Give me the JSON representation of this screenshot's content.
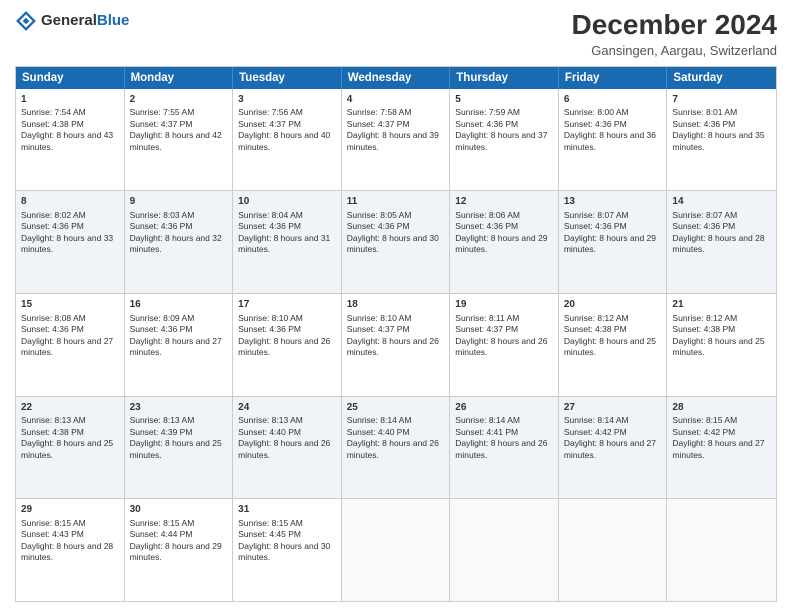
{
  "header": {
    "logo_general": "General",
    "logo_blue": "Blue",
    "title": "December 2024",
    "subtitle": "Gansingen, Aargau, Switzerland"
  },
  "calendar": {
    "days": [
      "Sunday",
      "Monday",
      "Tuesday",
      "Wednesday",
      "Thursday",
      "Friday",
      "Saturday"
    ],
    "weeks": [
      [
        {
          "day": "1",
          "sunrise": "Sunrise: 7:54 AM",
          "sunset": "Sunset: 4:38 PM",
          "daylight": "Daylight: 8 hours and 43 minutes."
        },
        {
          "day": "2",
          "sunrise": "Sunrise: 7:55 AM",
          "sunset": "Sunset: 4:37 PM",
          "daylight": "Daylight: 8 hours and 42 minutes."
        },
        {
          "day": "3",
          "sunrise": "Sunrise: 7:56 AM",
          "sunset": "Sunset: 4:37 PM",
          "daylight": "Daylight: 8 hours and 40 minutes."
        },
        {
          "day": "4",
          "sunrise": "Sunrise: 7:58 AM",
          "sunset": "Sunset: 4:37 PM",
          "daylight": "Daylight: 8 hours and 39 minutes."
        },
        {
          "day": "5",
          "sunrise": "Sunrise: 7:59 AM",
          "sunset": "Sunset: 4:36 PM",
          "daylight": "Daylight: 8 hours and 37 minutes."
        },
        {
          "day": "6",
          "sunrise": "Sunrise: 8:00 AM",
          "sunset": "Sunset: 4:36 PM",
          "daylight": "Daylight: 8 hours and 36 minutes."
        },
        {
          "day": "7",
          "sunrise": "Sunrise: 8:01 AM",
          "sunset": "Sunset: 4:36 PM",
          "daylight": "Daylight: 8 hours and 35 minutes."
        }
      ],
      [
        {
          "day": "8",
          "sunrise": "Sunrise: 8:02 AM",
          "sunset": "Sunset: 4:36 PM",
          "daylight": "Daylight: 8 hours and 33 minutes."
        },
        {
          "day": "9",
          "sunrise": "Sunrise: 8:03 AM",
          "sunset": "Sunset: 4:36 PM",
          "daylight": "Daylight: 8 hours and 32 minutes."
        },
        {
          "day": "10",
          "sunrise": "Sunrise: 8:04 AM",
          "sunset": "Sunset: 4:36 PM",
          "daylight": "Daylight: 8 hours and 31 minutes."
        },
        {
          "day": "11",
          "sunrise": "Sunrise: 8:05 AM",
          "sunset": "Sunset: 4:36 PM",
          "daylight": "Daylight: 8 hours and 30 minutes."
        },
        {
          "day": "12",
          "sunrise": "Sunrise: 8:06 AM",
          "sunset": "Sunset: 4:36 PM",
          "daylight": "Daylight: 8 hours and 29 minutes."
        },
        {
          "day": "13",
          "sunrise": "Sunrise: 8:07 AM",
          "sunset": "Sunset: 4:36 PM",
          "daylight": "Daylight: 8 hours and 29 minutes."
        },
        {
          "day": "14",
          "sunrise": "Sunrise: 8:07 AM",
          "sunset": "Sunset: 4:36 PM",
          "daylight": "Daylight: 8 hours and 28 minutes."
        }
      ],
      [
        {
          "day": "15",
          "sunrise": "Sunrise: 8:08 AM",
          "sunset": "Sunset: 4:36 PM",
          "daylight": "Daylight: 8 hours and 27 minutes."
        },
        {
          "day": "16",
          "sunrise": "Sunrise: 8:09 AM",
          "sunset": "Sunset: 4:36 PM",
          "daylight": "Daylight: 8 hours and 27 minutes."
        },
        {
          "day": "17",
          "sunrise": "Sunrise: 8:10 AM",
          "sunset": "Sunset: 4:36 PM",
          "daylight": "Daylight: 8 hours and 26 minutes."
        },
        {
          "day": "18",
          "sunrise": "Sunrise: 8:10 AM",
          "sunset": "Sunset: 4:37 PM",
          "daylight": "Daylight: 8 hours and 26 minutes."
        },
        {
          "day": "19",
          "sunrise": "Sunrise: 8:11 AM",
          "sunset": "Sunset: 4:37 PM",
          "daylight": "Daylight: 8 hours and 26 minutes."
        },
        {
          "day": "20",
          "sunrise": "Sunrise: 8:12 AM",
          "sunset": "Sunset: 4:38 PM",
          "daylight": "Daylight: 8 hours and 25 minutes."
        },
        {
          "day": "21",
          "sunrise": "Sunrise: 8:12 AM",
          "sunset": "Sunset: 4:38 PM",
          "daylight": "Daylight: 8 hours and 25 minutes."
        }
      ],
      [
        {
          "day": "22",
          "sunrise": "Sunrise: 8:13 AM",
          "sunset": "Sunset: 4:38 PM",
          "daylight": "Daylight: 8 hours and 25 minutes."
        },
        {
          "day": "23",
          "sunrise": "Sunrise: 8:13 AM",
          "sunset": "Sunset: 4:39 PM",
          "daylight": "Daylight: 8 hours and 25 minutes."
        },
        {
          "day": "24",
          "sunrise": "Sunrise: 8:13 AM",
          "sunset": "Sunset: 4:40 PM",
          "daylight": "Daylight: 8 hours and 26 minutes."
        },
        {
          "day": "25",
          "sunrise": "Sunrise: 8:14 AM",
          "sunset": "Sunset: 4:40 PM",
          "daylight": "Daylight: 8 hours and 26 minutes."
        },
        {
          "day": "26",
          "sunrise": "Sunrise: 8:14 AM",
          "sunset": "Sunset: 4:41 PM",
          "daylight": "Daylight: 8 hours and 26 minutes."
        },
        {
          "day": "27",
          "sunrise": "Sunrise: 8:14 AM",
          "sunset": "Sunset: 4:42 PM",
          "daylight": "Daylight: 8 hours and 27 minutes."
        },
        {
          "day": "28",
          "sunrise": "Sunrise: 8:15 AM",
          "sunset": "Sunset: 4:42 PM",
          "daylight": "Daylight: 8 hours and 27 minutes."
        }
      ],
      [
        {
          "day": "29",
          "sunrise": "Sunrise: 8:15 AM",
          "sunset": "Sunset: 4:43 PM",
          "daylight": "Daylight: 8 hours and 28 minutes."
        },
        {
          "day": "30",
          "sunrise": "Sunrise: 8:15 AM",
          "sunset": "Sunset: 4:44 PM",
          "daylight": "Daylight: 8 hours and 29 minutes."
        },
        {
          "day": "31",
          "sunrise": "Sunrise: 8:15 AM",
          "sunset": "Sunset: 4:45 PM",
          "daylight": "Daylight: 8 hours and 30 minutes."
        },
        null,
        null,
        null,
        null
      ]
    ]
  }
}
